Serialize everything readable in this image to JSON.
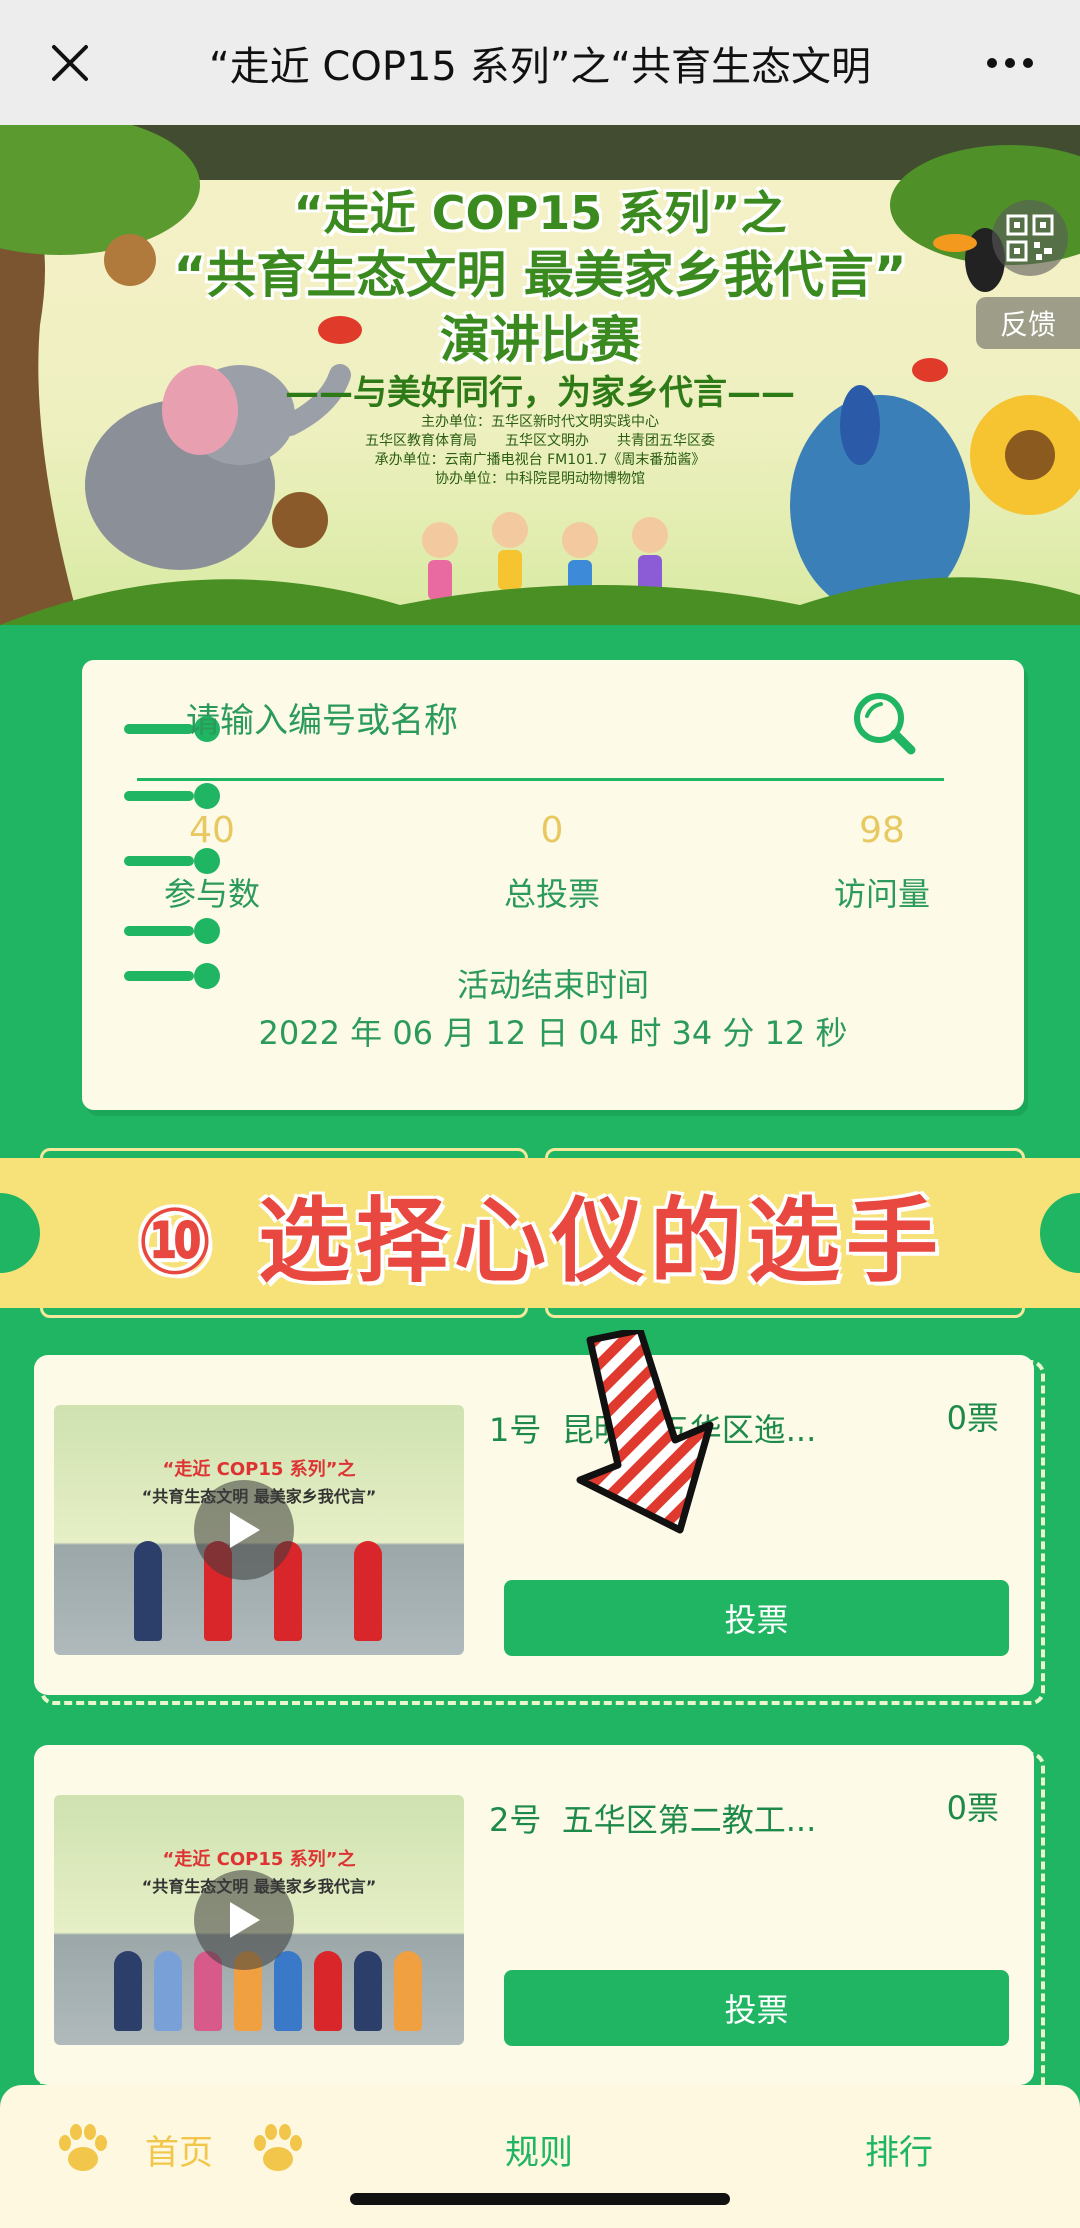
{
  "nav": {
    "title": "“走近 COP15 系列”之“共育生态文明",
    "close_icon": "close-icon",
    "more_icon": "more-icon"
  },
  "banner": {
    "title_line1": "“走近 COP15 系列”之",
    "title_line2": "“共育生态文明 最美家乡我代言”",
    "title_line3": "演讲比赛",
    "slogan": "——与美好同行，为家乡代言——",
    "orgs": [
      "主办单位：五华区新时代文明实践中心",
      "五华区教育体育局　　五华区文明办　　共青团五华区委",
      "承办单位：云南广播电视台 FM101.7《周末番茄酱》",
      "协办单位：中科院昆明动物博物馆"
    ],
    "feedback_label": "反馈"
  },
  "search": {
    "placeholder": "请输入编号或名称"
  },
  "stats": [
    {
      "value": "40",
      "label": "参与数"
    },
    {
      "value": "0",
      "label": "总投票"
    },
    {
      "value": "98",
      "label": "访问量"
    }
  ],
  "activity": {
    "end_label": "活动结束时间",
    "end_time": "2022 年 06 月 12 日 04 时 34 分 12 秒"
  },
  "promo": {
    "text": "⑩ 选择心仪的选手"
  },
  "entries": [
    {
      "number": "1号",
      "name": "昆明市五华区迤...",
      "votes": "0票",
      "vote_label": "投票",
      "thumb_title": "“走近 COP15 系列”之",
      "thumb_subtitle": "“共育生态文明 最美家乡我代言”"
    },
    {
      "number": "2号",
      "name": "五华区第二教工...",
      "votes": "0票",
      "vote_label": "投票",
      "thumb_title": "“走近 COP15 系列”之",
      "thumb_subtitle": "“共育生态文明 最美家乡我代言”"
    }
  ],
  "bottom_nav": {
    "home": "首页",
    "rules": "规则",
    "rank": "排行"
  },
  "colors": {
    "primary_green": "#1fb562",
    "card_bg": "#fdfbe8",
    "stat_yellow": "#e7c861",
    "promo_red": "#e8483f",
    "promo_yellow": "#f7e27a"
  }
}
